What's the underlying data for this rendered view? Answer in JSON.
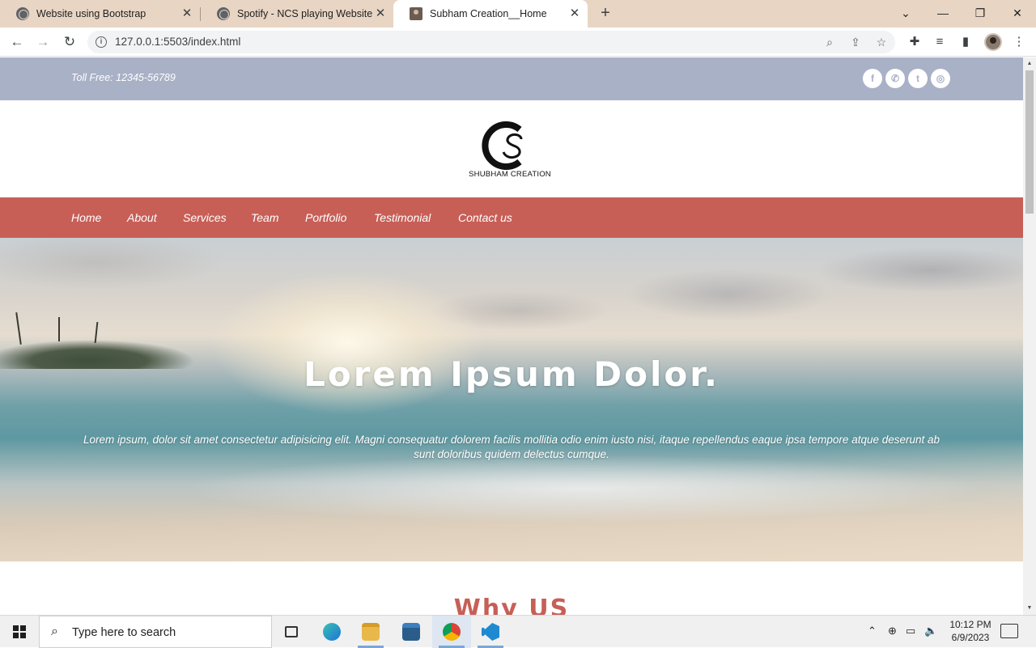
{
  "browser": {
    "tabs": [
      {
        "title": "Website using Bootstrap"
      },
      {
        "title": "Spotify - NCS playing Website"
      },
      {
        "title": "Subham Creation__Home"
      }
    ],
    "new_tab": "+",
    "url": "127.0.0.1:5503/index.html",
    "window_controls": {
      "minimize": "—",
      "restore": "❐",
      "close": "✕"
    }
  },
  "site": {
    "toll_free": "Toll Free: 12345-56789",
    "social": [
      {
        "icon": "facebook-icon",
        "glyph": "f"
      },
      {
        "icon": "whatsapp-icon",
        "glyph": "✆"
      },
      {
        "icon": "twitter-icon",
        "glyph": "t"
      },
      {
        "icon": "instagram-icon",
        "glyph": "◎"
      }
    ],
    "logo_text": "SHUBHAM CREATION",
    "nav": [
      "Home",
      "About",
      "Services",
      "Team",
      "Portfolio",
      "Testimonial",
      "Contact us"
    ],
    "hero": {
      "title": "Lorem Ipsum Dolor.",
      "text": "Lorem ipsum, dolor sit amet consectetur adipisicing elit. Magni consequatur dolorem facilis mollitia odio enim iusto nisi, itaque repellendus eaque ipsa tempore atque deserunt ab sunt doloribus quidem delectus cumque."
    },
    "section_title": "Why US",
    "colors": {
      "topbar": "#a9b1c6",
      "nav": "#c75f57",
      "accent": "#c75f57"
    }
  },
  "taskbar": {
    "search_placeholder": "Type here to search",
    "time": "10:12 PM",
    "date": "6/9/2023"
  }
}
